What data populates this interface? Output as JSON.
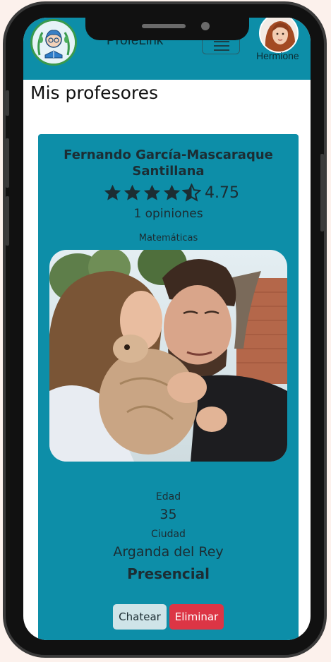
{
  "navbar": {
    "brand": "ProfeLink",
    "username": "Hermione",
    "logo_icon": "student-reading-logo",
    "menu_icon": "hamburger-icon",
    "bg_color": "#0d8ea8"
  },
  "page": {
    "title": "Mis profesores"
  },
  "teacher_card": {
    "name": "Fernando García-Mascaraque Santillana",
    "rating": {
      "value": "4.75",
      "stars_full": 4,
      "stars_half": 1,
      "star_icon": "star-icon"
    },
    "opinions": "1 opiniones",
    "subject": "Matemáticas",
    "photo_icon": "teacher-photo",
    "age_label": "Edad",
    "age_value": "35",
    "city_label": "Ciudad",
    "city_value": "Arganda del Rey",
    "modality": "Presencial",
    "chat_button": "Chatear",
    "delete_button": "Eliminar",
    "delete_color": "#dc3545"
  }
}
